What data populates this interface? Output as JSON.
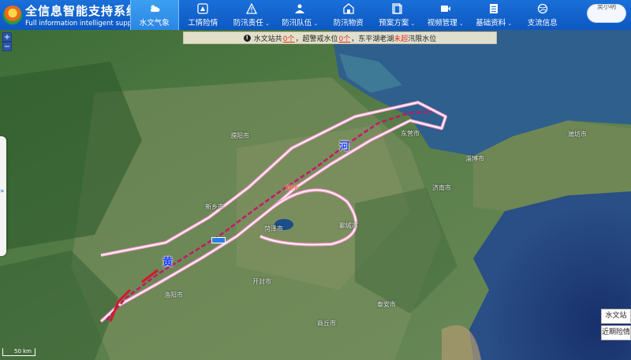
{
  "brand": {
    "title": "全信息智能支持系统",
    "subtitle": "Full information intelligent support sy"
  },
  "nav": [
    {
      "label": "水文气象",
      "icon": "cloud-sun-icon",
      "active": true,
      "dropdown": false
    },
    {
      "label": "工情险情",
      "icon": "engineering-icon",
      "active": false,
      "dropdown": false
    },
    {
      "label": "防汛责任",
      "icon": "warning-triangle-icon",
      "active": false,
      "dropdown": true
    },
    {
      "label": "防汛队伍",
      "icon": "team-icon",
      "active": false,
      "dropdown": true
    },
    {
      "label": "防汛物资",
      "icon": "warehouse-icon",
      "active": false,
      "dropdown": false
    },
    {
      "label": "预案方案",
      "icon": "document-icon",
      "active": false,
      "dropdown": true
    },
    {
      "label": "视频管理",
      "icon": "video-icon",
      "active": false,
      "dropdown": true
    },
    {
      "label": "基础资料",
      "icon": "folder-icon",
      "active": false,
      "dropdown": true
    },
    {
      "label": "支流信息",
      "icon": "globe-icon",
      "active": false,
      "dropdown": false
    }
  ],
  "user": {
    "label": "吴小明"
  },
  "notice": {
    "icon": "!",
    "prefix": "水文站共",
    "count1": "0个",
    "mid1": "，超警戒水位",
    "count2": "0个",
    "mid2": "，东平湖老湖",
    "flag": "未超",
    "suffix": "汛限水位"
  },
  "zoom": {
    "in": "+",
    "out": "−"
  },
  "side": {
    "arrow": "»"
  },
  "map": {
    "river_chars": [
      "黄",
      "河"
    ],
    "city_tag": "郑州",
    "labels": [
      "济南市",
      "淄博市",
      "泰安市",
      "聊城市",
      "开封市",
      "洛阳市",
      "新乡市",
      "商丘市",
      "菏泽市",
      "濮阳市",
      "潍坊市",
      "东营市"
    ]
  },
  "right_buttons": [
    "水文站",
    "近期险情"
  ],
  "scale": "50 km",
  "colors": {
    "header": "#1466d4",
    "active_tab": "#2f93ea",
    "river_line": "#c2186b",
    "levee": "#ffffff"
  }
}
